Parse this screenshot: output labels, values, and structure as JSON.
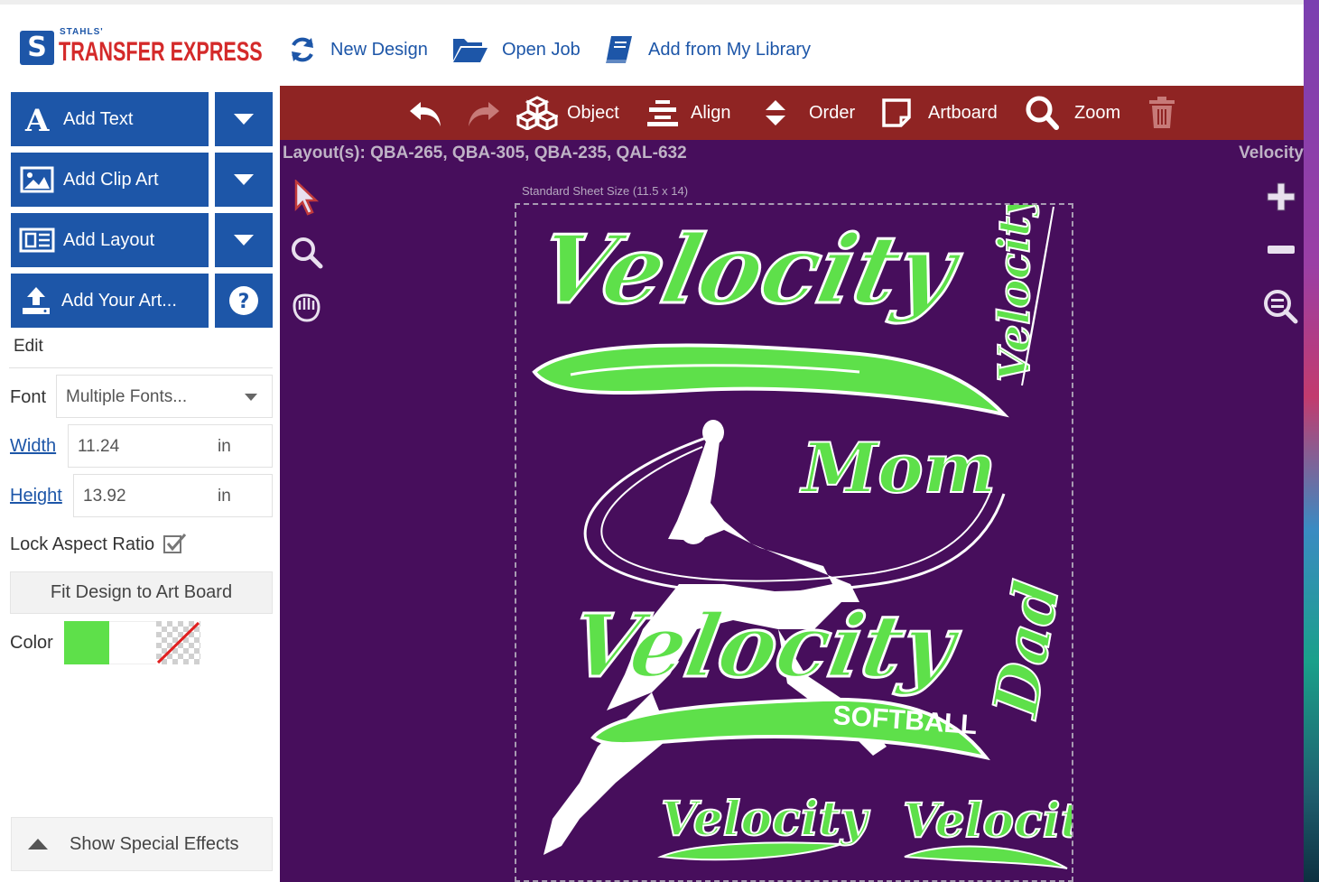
{
  "header": {
    "logo_small": "STAHLS'",
    "logo_big": "TRANSFER EXPRESS",
    "logo_mark": "S",
    "nav": [
      {
        "label": "New Design",
        "icon": "refresh-icon"
      },
      {
        "label": "Open Job",
        "icon": "folder-open-icon"
      },
      {
        "label": "Add from My Library",
        "icon": "book-icon"
      }
    ]
  },
  "sidebar": {
    "buttons": [
      {
        "label": "Add Text",
        "icon": "text-icon",
        "extra": "chevron-down-icon"
      },
      {
        "label": "Add Clip Art",
        "icon": "image-icon",
        "extra": "chevron-down-icon"
      },
      {
        "label": "Add Layout",
        "icon": "layout-icon",
        "extra": "chevron-down-icon"
      },
      {
        "label": "Add Your Art...",
        "icon": "upload-icon",
        "extra": "help-icon"
      }
    ],
    "edit_label": "Edit",
    "font_label": "Font",
    "font_value": "Multiple Fonts...",
    "width_label": "Width",
    "width_value": "11.24",
    "width_unit": "in",
    "height_label": "Height",
    "height_value": "13.92",
    "height_unit": "in",
    "lock_label": "Lock Aspect Ratio",
    "lock_checked": true,
    "fit_label": "Fit Design to Art Board",
    "color_label": "Color",
    "color_value": "#5ee04a",
    "special_label": "Show Special Effects"
  },
  "toolbar": {
    "items": [
      {
        "label": "",
        "icon": "undo-icon"
      },
      {
        "label": "",
        "icon": "redo-icon"
      },
      {
        "label": "Object",
        "icon": "cubes-icon"
      },
      {
        "label": "Align",
        "icon": "align-icon"
      },
      {
        "label": "Order",
        "icon": "sort-icon"
      },
      {
        "label": "Artboard",
        "icon": "artboard-icon"
      },
      {
        "label": "Zoom",
        "icon": "zoom-icon"
      },
      {
        "label": "",
        "icon": "trash-icon"
      }
    ]
  },
  "canvas": {
    "layouts_text": "Layout(s): QBA-265, QBA-305, QBA-235, QAL-632",
    "design_name": "Velocity",
    "sheet_label": "Standard Sheet Size (11.5 x 14)",
    "design_words": [
      "Velocity",
      "Velocity",
      "Mom",
      "Velocity",
      "SOFTBALL",
      "Dad",
      "Velocity",
      "Velocity"
    ]
  },
  "colors": {
    "brand_blue": "#1d56a8",
    "toolbar_red": "#8f2423",
    "canvas_purple": "#470e5c",
    "design_green": "#5ee04a",
    "logo_red": "#d42a2a"
  }
}
